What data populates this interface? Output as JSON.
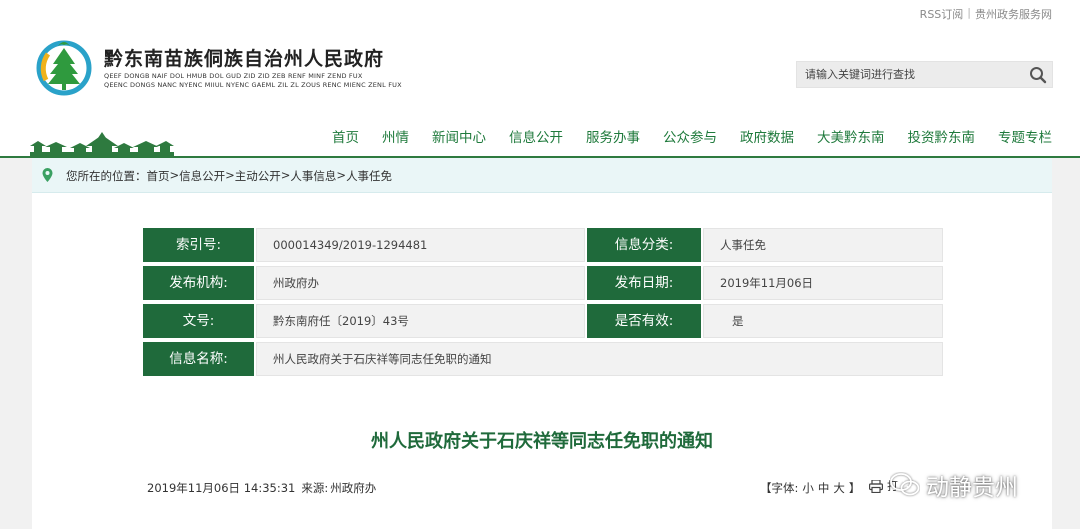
{
  "topbar": {
    "rss": "RSS订阅",
    "separator": "|",
    "service": "贵州政务服务网"
  },
  "site": {
    "title": "黔东南苗族侗族自治州人民政府",
    "subtitle_line1": "QEEF DONGB NAIF DOL HMUB DOL GUD ZID ZID ZEB RENF MINF ZEND FUX",
    "subtitle_line2": "QEENC DONGS NANC NYENC MIIUL NYENC GAEML ZIL ZL ZOUS RENC MIENC ZENL FUX"
  },
  "search": {
    "placeholder": "请输入关键词进行查找",
    "icon": "search-icon"
  },
  "nav": {
    "items": [
      "首页",
      "州情",
      "新闻中心",
      "信息公开",
      "服务办事",
      "公众参与",
      "政府数据",
      "大美黔东南",
      "投资黔东南",
      "专题专栏"
    ]
  },
  "breadcrumb": {
    "prefix": "您所在的位置：",
    "items": [
      "首页",
      "信息公开",
      "主动公开",
      "人事信息",
      "人事任免"
    ],
    "sep": ">"
  },
  "info": {
    "index_label": "索引号:",
    "index_value": "000014349/2019-1294481",
    "category_label": "信息分类:",
    "category_value": "人事任免",
    "org_label": "发布机构:",
    "org_value": "州政府办",
    "date_label": "发布日期:",
    "date_value": "2019年11月06日",
    "docno_label": "文号:",
    "docno_value": "黔东南府任〔2019〕43号",
    "valid_label": "是否有效:",
    "valid_value": "是",
    "name_label": "信息名称:",
    "name_value": "州人民政府关于石庆祥等同志任免职的通知"
  },
  "doc": {
    "title": "州人民政府关于石庆祥等同志任免职的通知",
    "datetime": "2019年11月06日 14:35:31",
    "source_label": "来源:",
    "source": "州政府办",
    "font_label": "【字体:",
    "font_small": "小",
    "font_medium": "中",
    "font_large": "大",
    "font_close": "】",
    "print_label": "打"
  },
  "watermark": {
    "text": "动静贵州",
    "icon": "wechat-icon"
  },
  "colors": {
    "brand_green": "#1f6a3b",
    "nav_green": "#1f7a3c",
    "breadcrumb_bg": "#eaf6f7"
  }
}
